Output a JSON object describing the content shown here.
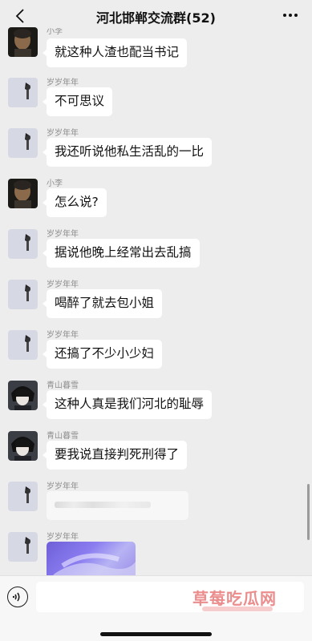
{
  "header": {
    "title": "河北邯郸交流群(52)"
  },
  "messages": [
    {
      "sender": "小李",
      "text": "就这种人渣也配当书记",
      "avatar": "dark-portrait"
    },
    {
      "sender": "岁岁年年",
      "text": "不可思议",
      "avatar": "light-figure"
    },
    {
      "sender": "岁岁年年",
      "text": "我还听说他私生活乱的一比",
      "avatar": "light-figure"
    },
    {
      "sender": "小李",
      "text": "怎么说?",
      "avatar": "dark-portrait"
    },
    {
      "sender": "岁岁年年",
      "text": "据说他晚上经常出去乱搞",
      "avatar": "light-figure"
    },
    {
      "sender": "岁岁年年",
      "text": "喝醉了就去包小姐",
      "avatar": "light-figure"
    },
    {
      "sender": "岁岁年年",
      "text": "还搞了不少小少妇",
      "avatar": "light-figure"
    },
    {
      "sender": "青山暮雪",
      "text": "这种人真是我们河北的耻辱",
      "avatar": "anime-portrait"
    },
    {
      "sender": "青山暮雪",
      "text": "要我说直接判死刑得了",
      "avatar": "anime-portrait"
    },
    {
      "sender": "岁岁年年",
      "text": "",
      "avatar": "light-figure",
      "content_type": "blurred-text"
    },
    {
      "sender": "岁岁年年",
      "text": "",
      "avatar": "light-figure",
      "content_type": "image"
    }
  ],
  "input_bar": {
    "watermark": "草莓吃瓜网"
  },
  "icons": {
    "back": "back-chevron-icon",
    "more": "more-dots-icon",
    "voice": "voice-input-icon"
  },
  "colors": {
    "background": "#ededed",
    "bubble": "#ffffff",
    "name_text": "#8e8e8e",
    "watermark": "#e87a7a"
  }
}
